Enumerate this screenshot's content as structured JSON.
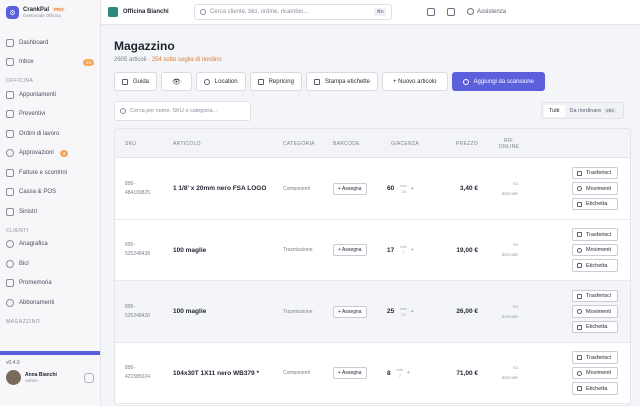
{
  "app": {
    "name": "CrankPal",
    "badge": "PRO",
    "subtitle": "Gestionale Officina"
  },
  "sidebar": {
    "items_top": [
      {
        "label": "Dashboard",
        "icon": "grid-icon"
      },
      {
        "label": "Inbox",
        "icon": "inbox-icon",
        "badge": "14"
      }
    ],
    "section_officina": "OFFICINA",
    "items_officina": [
      {
        "label": "Appuntamenti",
        "icon": "calendar-icon"
      },
      {
        "label": "Preventivi",
        "icon": "document-icon"
      },
      {
        "label": "Ordini di lavoro",
        "icon": "wrench-icon"
      },
      {
        "label": "Approvazioni",
        "icon": "check-circle-icon",
        "badge": "3"
      },
      {
        "label": "Fatture e scontrini",
        "icon": "receipt-icon"
      },
      {
        "label": "Cassa & POS",
        "icon": "register-icon"
      },
      {
        "label": "Sinistri",
        "icon": "shield-icon"
      }
    ],
    "section_clienti": "CLIENTI",
    "items_clienti": [
      {
        "label": "Anagrafica",
        "icon": "users-icon"
      },
      {
        "label": "Bici",
        "icon": "bike-icon"
      },
      {
        "label": "Promemoria",
        "icon": "bell-icon"
      },
      {
        "label": "Abbonamenti",
        "icon": "refresh-icon"
      }
    ],
    "section_magazzino": "MAGAZZINO",
    "version": "v0.4.9",
    "user": {
      "name": "Anna Bianchi",
      "role": "Admin"
    }
  },
  "topbar": {
    "shop_name": "Officina Bianchi",
    "search_placeholder": "Cerca cliente, bici, ordine, ricambio...",
    "shortcut": "⌘K",
    "assist_label": "Assistenza"
  },
  "page": {
    "title": "Magazzino",
    "count_text": "2605 articoli · ",
    "warning_text": "254 sotto soglia di riordino"
  },
  "actions": {
    "guide": "Guida",
    "location": "Location",
    "repricing": "Repricing",
    "print_labels": "Stampa etichette",
    "new_item": "+ Nuovo articolo",
    "scan_add": "Aggiungi da scansione"
  },
  "search": {
    "placeholder": "Cerca per nome, SKU o categoria..."
  },
  "filters": {
    "all": "Tutti",
    "reorder": "Da riordinare",
    "reorder_count": "254"
  },
  "table": {
    "headers": {
      "sku": "SKU",
      "article": "ARTICOLO",
      "category": "CATEGORIA",
      "barcode": "BARCODE",
      "stock": "GIACENZA",
      "price": "PREZZO",
      "online_ref_1": "RIF.",
      "online_ref_2": "ONLINE"
    },
    "assign_label": "+ Assegna",
    "min_label": "min",
    "no_barcode_1": "no",
    "no_barcode_2": "barcode",
    "op_transfer": "Trasferisci",
    "op_moves": "Movimenti",
    "op_label": "Etichetta",
    "rows": [
      {
        "sku_1": "895-",
        "sku_2": "484109825",
        "name": "1 1/8' x 20mm nero FSA LOGO",
        "category": "Componenti",
        "qty": "60",
        "min": "18",
        "price": "3,40 €"
      },
      {
        "sku_1": "895-",
        "sku_2": "525248438",
        "name": "100 maglie",
        "category": "Trasmissione",
        "qty": "17",
        "min": "7",
        "price": "19,00 €"
      },
      {
        "sku_1": "895-",
        "sku_2": "525248420",
        "name": "100 maglie",
        "category": "Trasmissione",
        "qty": "25",
        "min": "12",
        "price": "26,00 €"
      },
      {
        "sku_1": "895-",
        "sku_2": "421585024",
        "name": "104x30T 1X11 nero WB379 *",
        "category": "Componenti",
        "qty": "8",
        "min": "7",
        "price": "71,00 €"
      }
    ]
  }
}
